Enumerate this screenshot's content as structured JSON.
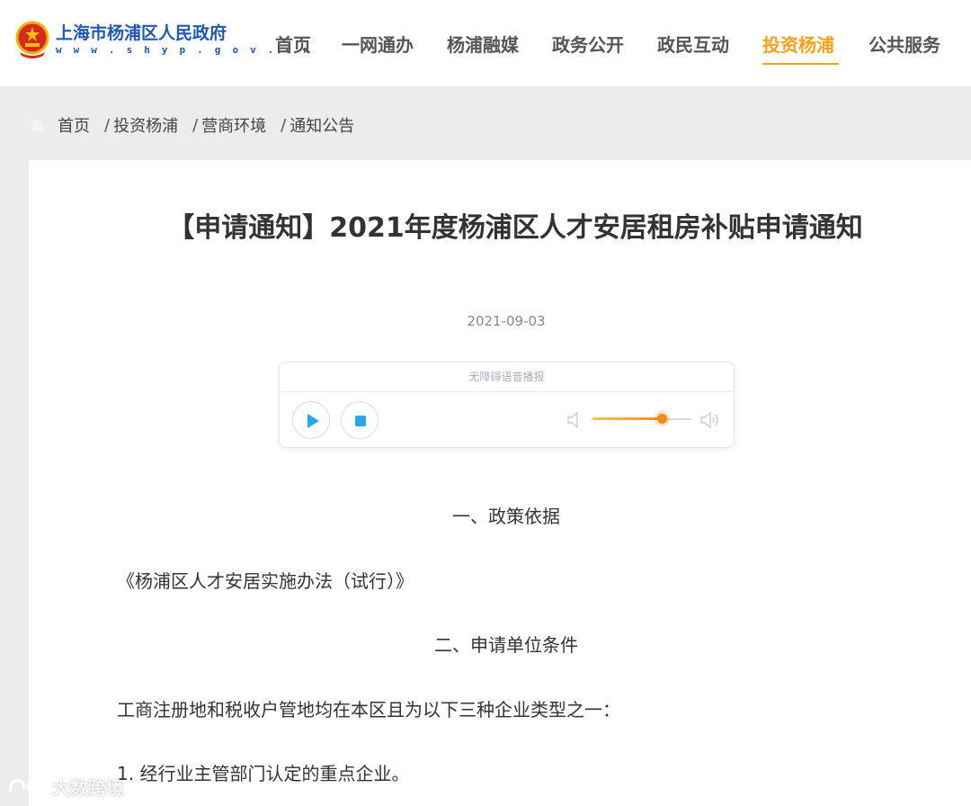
{
  "header": {
    "site_name": "上海市杨浦区人民政府",
    "site_url": "w w w . s h y p . g o v . c n",
    "nav": [
      {
        "label": "首页"
      },
      {
        "label": "一网通办"
      },
      {
        "label": "杨浦融媒"
      },
      {
        "label": "政务公开"
      },
      {
        "label": "政民互动"
      },
      {
        "label": "投资杨浦",
        "active": true
      },
      {
        "label": "公共服务"
      }
    ],
    "accent_color": "#f5a219",
    "brand_color": "#1f58b0"
  },
  "breadcrumb": {
    "items": [
      "首页",
      "投资杨浦",
      "营商环境",
      "通知公告"
    ],
    "separator": "/"
  },
  "article": {
    "title": "【申请通知】2021年度杨浦区人才安居租房补贴申请通知",
    "date": "2021-09-03",
    "player": {
      "heading": "无障碍语音播报",
      "volume": 0.75,
      "play_icon": "play-icon",
      "stop_icon": "stop-icon"
    },
    "paragraphs": [
      "一、政策依据",
      "《杨浦区人才安居实施办法（试行）》",
      "二、申请单位条件",
      "工商注册地和税收户管地均在本区且为以下三种企业类型之一：",
      "1. 经行业主管部门认定的重点企业。"
    ]
  },
  "watermark": {
    "text": "大数跨境"
  }
}
